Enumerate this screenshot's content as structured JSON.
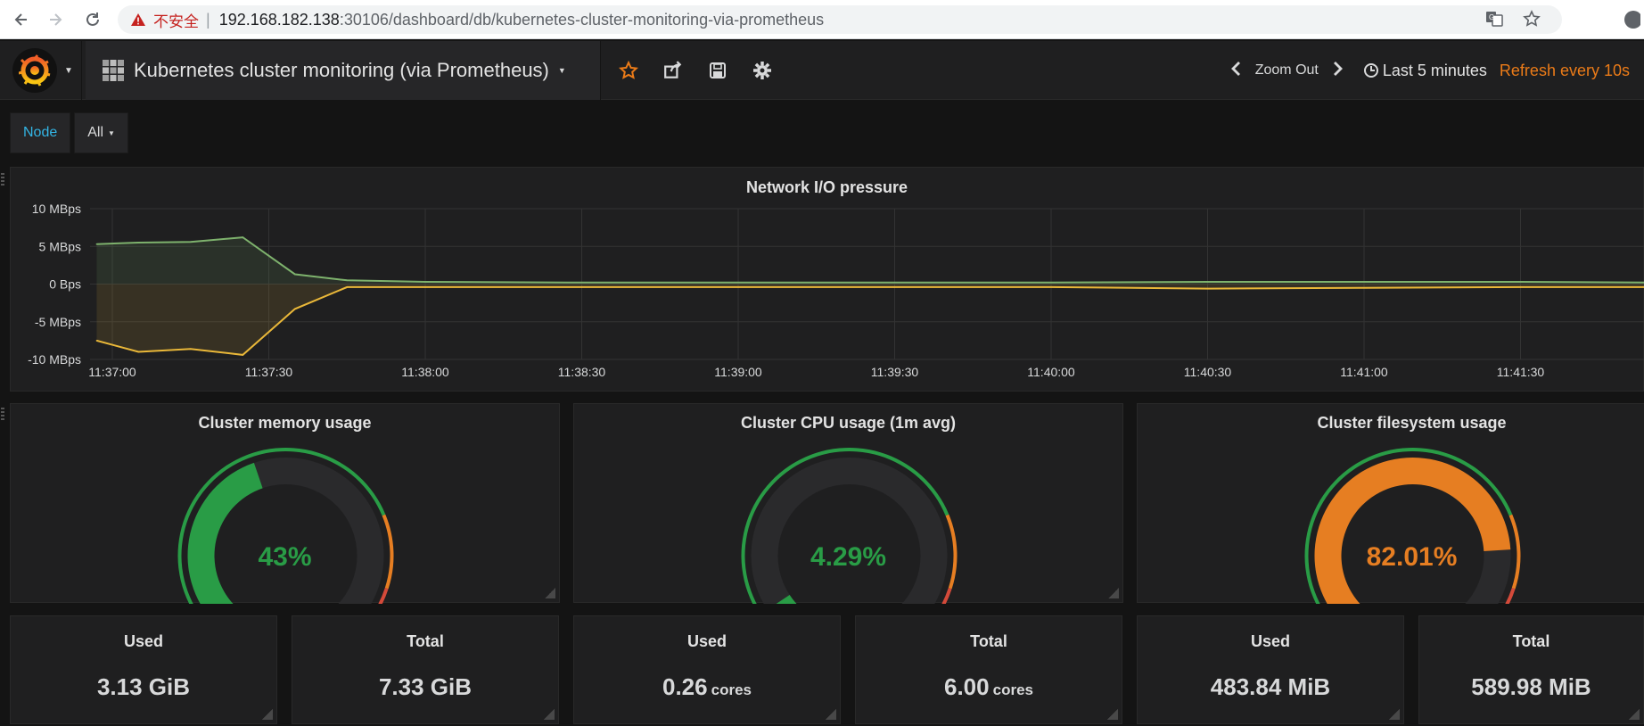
{
  "browser": {
    "security_label": "不安全",
    "url_host": "192.168.182.138",
    "url_rest": ":30106/dashboard/db/kubernetes-cluster-monitoring-via-prometheus"
  },
  "nav": {
    "dashboard_title": "Kubernetes cluster monitoring (via Prometheus)",
    "zoom_out": "Zoom Out",
    "time_range": "Last 5 minutes",
    "refresh": "Refresh every 10s"
  },
  "variables": {
    "label": "Node",
    "value": "All"
  },
  "network_panel": {
    "title": "Network I/O pressure"
  },
  "chart_data": {
    "type": "line",
    "title": "Network I/O pressure",
    "ylim": [
      -10,
      10
    ],
    "yticks": [
      "10 MBps",
      "5 MBps",
      "0 Bps",
      "-5 MBps",
      "-10 MBps"
    ],
    "ytick_values": [
      10,
      5,
      0,
      -5,
      -10
    ],
    "xticks": [
      "11:37:00",
      "11:37:30",
      "11:38:00",
      "11:38:30",
      "11:39:00",
      "11:39:30",
      "11:40:00",
      "11:40:30",
      "11:41:00",
      "11:41:30"
    ],
    "x": [
      "11:36:57",
      "11:37:05",
      "11:37:15",
      "11:37:25",
      "11:37:35",
      "11:37:45",
      "11:38:00",
      "11:38:30",
      "11:39:00",
      "11:39:30",
      "11:40:00",
      "11:40:30",
      "11:41:00",
      "11:41:30",
      "11:42:00"
    ],
    "series": [
      {
        "values": [
          5.3,
          5.5,
          5.6,
          6.2,
          1.3,
          0.5,
          0.3,
          0.2,
          0.2,
          0.2,
          0.2,
          0.3,
          0.3,
          0.3,
          0.2
        ],
        "color": "#7eb26d"
      },
      {
        "values": [
          -7.5,
          -9.0,
          -8.6,
          -9.4,
          -3.3,
          -0.4,
          -0.4,
          -0.4,
          -0.4,
          -0.4,
          -0.4,
          -0.6,
          -0.5,
          -0.4,
          -0.4
        ],
        "color": "#eab839"
      }
    ]
  },
  "gauges": [
    {
      "title": "Cluster memory usage",
      "value_text": "43%",
      "value": 0.43,
      "color": "#299c46"
    },
    {
      "title": "Cluster CPU usage (1m avg)",
      "value_text": "4.29%",
      "value": 0.0429,
      "color": "#299c46"
    },
    {
      "title": "Cluster filesystem usage",
      "value_text": "82.01%",
      "value": 0.8201,
      "color": "#e67e22"
    }
  ],
  "stats": [
    {
      "title": "Used",
      "value": "3.13 GiB",
      "unit": ""
    },
    {
      "title": "Total",
      "value": "7.33 GiB",
      "unit": ""
    },
    {
      "title": "Used",
      "value": "0.26",
      "unit": "cores"
    },
    {
      "title": "Total",
      "value": "6.00",
      "unit": "cores"
    },
    {
      "title": "Used",
      "value": "483.84 MiB",
      "unit": ""
    },
    {
      "title": "Total",
      "value": "589.98 MiB",
      "unit": ""
    }
  ]
}
